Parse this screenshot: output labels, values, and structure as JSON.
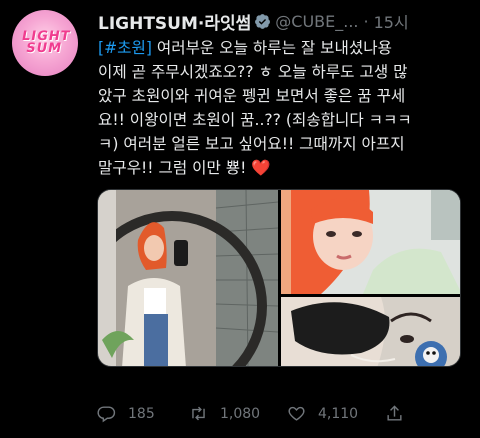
{
  "tweet": {
    "author_name": "LIGHTSUM·라잇썸",
    "handle": "@CUBE_...",
    "separator": "·",
    "time": "15시",
    "more_label": "···",
    "lines": [
      {
        "hashtag": "[#초원]",
        "text": " 여러부운 오늘 하루는 잘 보내셨나용"
      },
      {
        "hashtag": "",
        "text": "이제 곧 주무시겠죠오?? ㅎ 오늘 하루도 고생 많"
      },
      {
        "hashtag": "",
        "text": "았구 초원이와 귀여운 펭귄 보면서 좋은 꿈 꾸세"
      },
      {
        "hashtag": "",
        "text": "요!! 이왕이면 초원이 꿈..?? (죄송합니다 ㅋㅋㅋ"
      },
      {
        "hashtag": "",
        "text": "ㅋ) 여러분 얼른 보고 싶어요!! 그때까지 아프지"
      },
      {
        "hashtag": "",
        "text": "말구우!! 그럼 이만 뿅! ❤️"
      }
    ],
    "logo_text": "LIGHT SUM"
  },
  "media": {
    "photo_left_label": "selfie-mirror-photo",
    "photo_right_top_label": "closeup-photo",
    "photo_right_bottom_label": "masked-photo"
  },
  "actions": {
    "reply_count": "185",
    "retweet_count": "1,080",
    "like_count": "4,110"
  },
  "colors": {
    "background": "#000000",
    "text": "#e7e9ea",
    "muted": "#71767b",
    "link": "#1d9bf0",
    "verified": "#829aab"
  }
}
